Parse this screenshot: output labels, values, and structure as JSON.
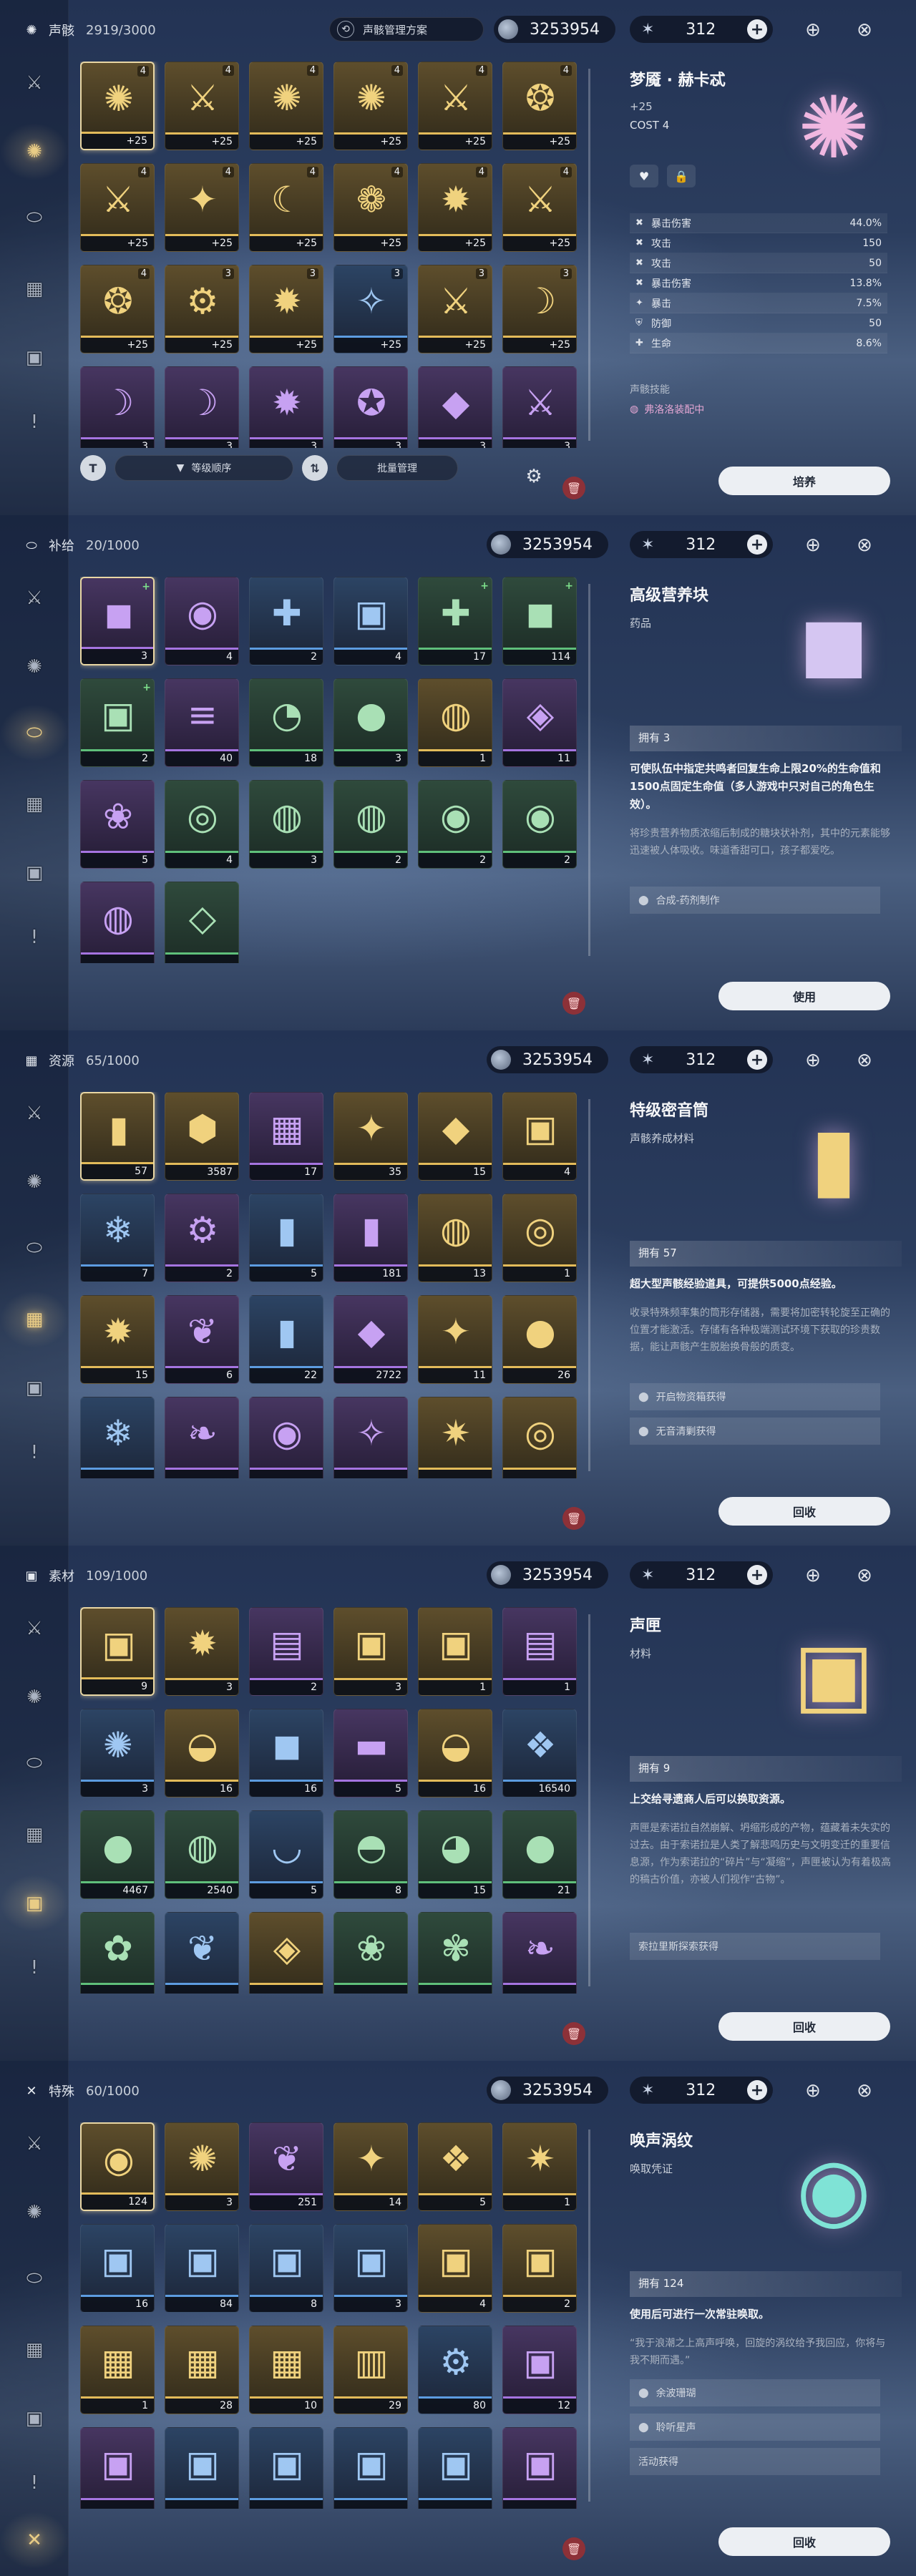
{
  "common": {
    "coins": "3253954",
    "astrite": "312",
    "trash_icon": "trash-icon"
  },
  "panels": [
    {
      "category": "声骸",
      "count": "2919/3000",
      "cat_icon": "echo-icon",
      "scheme_label": "声骸管理方案",
      "sort_label": "等级顺序",
      "bulk_label": "批量管理",
      "detail": {
        "name": "梦魇 · 赫卡忒",
        "level": "+25",
        "cost": "COST  4",
        "stats": [
          [
            "暴击伤害",
            "44.0%"
          ],
          [
            "攻击",
            "150"
          ],
          [
            "攻击",
            "50"
          ],
          [
            "暴击伤害",
            "13.8%"
          ],
          [
            "暴击",
            "7.5%"
          ],
          [
            "防御",
            "50"
          ],
          [
            "生命",
            "8.6%"
          ]
        ],
        "skill_label": "声骸技能",
        "equip_label": "弗洛洛装配中"
      },
      "button": "培养",
      "items": [
        {
          "icon": "echo-hecate",
          "glyph": "✺",
          "rarity": "gold",
          "cnt": "+25",
          "cost": "4",
          "sel": true
        },
        {
          "icon": "echo-knight",
          "glyph": "⚔",
          "rarity": "gold",
          "cnt": "+25",
          "cost": "4"
        },
        {
          "icon": "echo-hecate",
          "glyph": "✺",
          "rarity": "gold",
          "cnt": "+25",
          "cost": "4"
        },
        {
          "icon": "echo-hecate",
          "glyph": "✺",
          "rarity": "gold",
          "cnt": "+25",
          "cost": "4"
        },
        {
          "icon": "echo-knight",
          "glyph": "⚔",
          "rarity": "gold",
          "cnt": "+25",
          "cost": "4"
        },
        {
          "icon": "echo-guardian",
          "glyph": "❂",
          "rarity": "gold",
          "cnt": "+25",
          "cost": "4"
        },
        {
          "icon": "echo-knight",
          "glyph": "⚔",
          "rarity": "gold",
          "cnt": "+25",
          "cost": "4"
        },
        {
          "icon": "echo-guardian",
          "glyph": "✦",
          "rarity": "gold",
          "cnt": "+25",
          "cost": "4"
        },
        {
          "icon": "echo-serpent",
          "glyph": "☾",
          "rarity": "gold",
          "cnt": "+25",
          "cost": "4"
        },
        {
          "icon": "echo-dragon",
          "glyph": "❁",
          "rarity": "gold",
          "cnt": "+25",
          "cost": "4"
        },
        {
          "icon": "echo-beast",
          "glyph": "✹",
          "rarity": "gold",
          "cnt": "+25",
          "cost": "4"
        },
        {
          "icon": "echo-knight",
          "glyph": "⚔",
          "rarity": "gold",
          "cnt": "+25",
          "cost": "4"
        },
        {
          "icon": "echo-guardian",
          "glyph": "❂",
          "rarity": "gold",
          "cnt": "+25",
          "cost": "4"
        },
        {
          "icon": "echo-mech",
          "glyph": "⚙",
          "rarity": "gold",
          "cnt": "+25",
          "cost": "3"
        },
        {
          "icon": "echo-beast",
          "glyph": "✹",
          "rarity": "gold",
          "cnt": "+25",
          "cost": "3"
        },
        {
          "icon": "echo-crystal",
          "glyph": "✧",
          "rarity": "blue",
          "cnt": "+25",
          "cost": "3"
        },
        {
          "icon": "echo-knight",
          "glyph": "⚔",
          "rarity": "gold",
          "cnt": "+25",
          "cost": "3"
        },
        {
          "icon": "echo-scythe",
          "glyph": "☽",
          "rarity": "gold",
          "cnt": "+25",
          "cost": "3"
        },
        {
          "icon": "echo-scythe",
          "glyph": "☽",
          "rarity": "purple",
          "cnt": "3",
          "cost": ""
        },
        {
          "icon": "echo-scythe",
          "glyph": "☽",
          "rarity": "purple",
          "cnt": "3",
          "cost": ""
        },
        {
          "icon": "echo-beast",
          "glyph": "✹",
          "rarity": "purple",
          "cnt": "3",
          "cost": ""
        },
        {
          "icon": "echo-orb",
          "glyph": "✪",
          "rarity": "purple",
          "cnt": "3",
          "cost": ""
        },
        {
          "icon": "echo-rock",
          "glyph": "◆",
          "rarity": "purple",
          "cnt": "3",
          "cost": ""
        },
        {
          "icon": "echo-knight",
          "glyph": "⚔",
          "rarity": "purple",
          "cnt": "3",
          "cost": ""
        }
      ]
    },
    {
      "category": "补给",
      "count": "20/1000",
      "cat_icon": "pill-icon",
      "detail": {
        "name": "高级营养块",
        "sub": "药品",
        "own": "拥有 3",
        "desc": "可使队伍中指定共鸣者回复生命上限20%的生命值和1500点固定生命值（多人游戏中只对自己的角色生效）。",
        "flavor": "将珍贵营养物质浓缩后制成的糖块状补剂，其中的元素能够迅速被人体吸收。味道香甜可口，孩子都爱吃。",
        "sources": [
          "合成-药剂制作"
        ]
      },
      "button": "使用",
      "items": [
        {
          "icon": "nutrient-block",
          "glyph": "◼",
          "rarity": "purple",
          "cnt": "3",
          "sel": true,
          "tag": "+"
        },
        {
          "icon": "stew",
          "glyph": "◉",
          "rarity": "purple",
          "cnt": "4",
          "tag": ""
        },
        {
          "icon": "bandage",
          "glyph": "✚",
          "rarity": "blue",
          "cnt": "2",
          "tag": ""
        },
        {
          "icon": "medkit",
          "glyph": "▣",
          "rarity": "blue",
          "cnt": "4",
          "tag": ""
        },
        {
          "icon": "bandage",
          "glyph": "✚",
          "rarity": "green",
          "cnt": "17",
          "tag": "+"
        },
        {
          "icon": "nutrient-block",
          "glyph": "◼",
          "rarity": "green",
          "cnt": "114",
          "tag": "+"
        },
        {
          "icon": "medkit",
          "glyph": "▣",
          "rarity": "green",
          "cnt": "2",
          "tag": "+"
        },
        {
          "icon": "skewer",
          "glyph": "≡",
          "rarity": "purple",
          "cnt": "40",
          "tag": ""
        },
        {
          "icon": "pie",
          "glyph": "◔",
          "rarity": "green",
          "cnt": "18",
          "tag": ""
        },
        {
          "icon": "dumpling",
          "glyph": "●",
          "rarity": "green",
          "cnt": "3",
          "tag": ""
        },
        {
          "icon": "soup",
          "glyph": "◍",
          "rarity": "gold",
          "cnt": "1",
          "tag": ""
        },
        {
          "icon": "grill",
          "glyph": "◈",
          "rarity": "purple",
          "cnt": "11",
          "tag": ""
        },
        {
          "icon": "berry-bowl",
          "glyph": "❀",
          "rarity": "purple",
          "cnt": "5",
          "tag": ""
        },
        {
          "icon": "rice-bowl",
          "glyph": "◎",
          "rarity": "green",
          "cnt": "4",
          "tag": ""
        },
        {
          "icon": "noodles",
          "glyph": "◍",
          "rarity": "green",
          "cnt": "3",
          "tag": ""
        },
        {
          "icon": "noodles",
          "glyph": "◍",
          "rarity": "green",
          "cnt": "2",
          "tag": ""
        },
        {
          "icon": "curry",
          "glyph": "◉",
          "rarity": "green",
          "cnt": "2",
          "tag": ""
        },
        {
          "icon": "curry",
          "glyph": "◉",
          "rarity": "green",
          "cnt": "2",
          "tag": ""
        },
        {
          "icon": "soup",
          "glyph": "◍",
          "rarity": "purple",
          "cnt": "",
          "tag": ""
        },
        {
          "icon": "pastry",
          "glyph": "◇",
          "rarity": "green",
          "cnt": "",
          "tag": ""
        }
      ]
    },
    {
      "category": "资源",
      "count": "65/1000",
      "cat_icon": "resource-icon",
      "detail": {
        "name": "特级密音筒",
        "sub": "声骸养成材料",
        "own": "拥有 57",
        "desc": "超大型声骸经验道具，可提供5000点经验。",
        "flavor": "收录特殊频率集的筒形存储器，需要将加密转轮旋至正确的位置才能激活。存储有各种极端测试环境下获取的珍贵数据，能让声骸产生脱胎换骨般的质变。",
        "sources": [
          "开启物资箱获得",
          "无音清剿获得"
        ]
      },
      "button": "回收",
      "items": [
        {
          "icon": "premium-tuner",
          "glyph": "▮",
          "rarity": "gold",
          "cnt": "57",
          "sel": true
        },
        {
          "icon": "shell-credit",
          "glyph": "⬢",
          "rarity": "gold",
          "cnt": "3587"
        },
        {
          "icon": "sealed-tube",
          "glyph": "▦",
          "rarity": "purple",
          "cnt": "17"
        },
        {
          "icon": "star-shard",
          "glyph": "✦",
          "rarity": "gold",
          "cnt": "35"
        },
        {
          "icon": "crystal-ore",
          "glyph": "◆",
          "rarity": "gold",
          "cnt": "15"
        },
        {
          "icon": "cube-core",
          "glyph": "▣",
          "rarity": "gold",
          "cnt": "4"
        },
        {
          "icon": "ice-shard",
          "glyph": "❄",
          "rarity": "blue",
          "cnt": "7"
        },
        {
          "icon": "mech-core",
          "glyph": "⚙",
          "rarity": "purple",
          "cnt": "2"
        },
        {
          "icon": "tube",
          "glyph": "▮",
          "rarity": "blue",
          "cnt": "5"
        },
        {
          "icon": "medium-tube",
          "glyph": "▮",
          "rarity": "purple",
          "cnt": "181"
        },
        {
          "icon": "orb",
          "glyph": "◍",
          "rarity": "gold",
          "cnt": "13"
        },
        {
          "icon": "spiral-shell",
          "glyph": "◎",
          "rarity": "gold",
          "cnt": "1"
        },
        {
          "icon": "flame-crystal",
          "glyph": "✹",
          "rarity": "gold",
          "cnt": "15"
        },
        {
          "icon": "feather",
          "glyph": "❦",
          "rarity": "purple",
          "cnt": "6"
        },
        {
          "icon": "tube-small",
          "glyph": "▮",
          "rarity": "blue",
          "cnt": "22"
        },
        {
          "icon": "purple-gem",
          "glyph": "◆",
          "rarity": "purple",
          "cnt": "2722"
        },
        {
          "icon": "star-shard",
          "glyph": "✦",
          "rarity": "gold",
          "cnt": "11"
        },
        {
          "icon": "dark-orb",
          "glyph": "●",
          "rarity": "gold",
          "cnt": "26"
        },
        {
          "icon": "ice-shard",
          "glyph": "❄",
          "rarity": "blue",
          "cnt": ""
        },
        {
          "icon": "claw",
          "glyph": "❧",
          "rarity": "purple",
          "cnt": ""
        },
        {
          "icon": "red-core",
          "glyph": "◉",
          "rarity": "purple",
          "cnt": ""
        },
        {
          "icon": "star-shard",
          "glyph": "✧",
          "rarity": "purple",
          "cnt": ""
        },
        {
          "icon": "sun-star",
          "glyph": "✷",
          "rarity": "gold",
          "cnt": ""
        },
        {
          "icon": "spiral-shell",
          "glyph": "◎",
          "rarity": "gold",
          "cnt": ""
        }
      ]
    },
    {
      "category": "素材",
      "count": "109/1000",
      "cat_icon": "material-icon",
      "detail": {
        "name": "声匣",
        "sub": "材料",
        "own": "拥有 9",
        "desc": "上交给寻遗商人后可以换取资源。",
        "flavor": "声匣是索诺拉自然崩解、坍缩形成的产物，蕴藏着未失实的过去。由于索诺拉是人类了解悲鸣历史与文明变迁的重要信息源，作为索诺拉的“碎片”与“凝缩”，声匣被认为有着极高的稿古价值，亦被人们视作“古物”。",
        "sources": [
          "索拉里斯探索获得"
        ]
      },
      "button": "回收",
      "items": [
        {
          "icon": "sound-box",
          "glyph": "▣",
          "rarity": "gold",
          "cnt": "9",
          "sel": true
        },
        {
          "icon": "golden-spark",
          "glyph": "✹",
          "rarity": "gold",
          "cnt": "3"
        },
        {
          "icon": "data-card",
          "glyph": "▤",
          "rarity": "purple",
          "cnt": "2"
        },
        {
          "icon": "sound-box",
          "glyph": "▣",
          "rarity": "gold",
          "cnt": "3"
        },
        {
          "icon": "sound-box",
          "glyph": "▣",
          "rarity": "gold",
          "cnt": "1"
        },
        {
          "icon": "data-card",
          "glyph": "▤",
          "rarity": "purple",
          "cnt": "1"
        },
        {
          "icon": "whirl",
          "glyph": "✺",
          "rarity": "blue",
          "cnt": "3"
        },
        {
          "icon": "potion",
          "glyph": "◒",
          "rarity": "gold",
          "cnt": "16"
        },
        {
          "icon": "metal-cube",
          "glyph": "◼",
          "rarity": "blue",
          "cnt": "16"
        },
        {
          "icon": "brick",
          "glyph": "▬",
          "rarity": "purple",
          "cnt": "5"
        },
        {
          "icon": "potion",
          "glyph": "◒",
          "rarity": "gold",
          "cnt": "16"
        },
        {
          "icon": "blue-crystal",
          "glyph": "❖",
          "rarity": "blue",
          "cnt": "16540"
        },
        {
          "icon": "stone-ball",
          "glyph": "●",
          "rarity": "green",
          "cnt": "4467"
        },
        {
          "icon": "green-capsule",
          "glyph": "◍",
          "rarity": "green",
          "cnt": "2540"
        },
        {
          "icon": "tea-cup",
          "glyph": "◡",
          "rarity": "blue",
          "cnt": "5"
        },
        {
          "icon": "bowl",
          "glyph": "◓",
          "rarity": "green",
          "cnt": "8"
        },
        {
          "icon": "bread",
          "glyph": "◕",
          "rarity": "green",
          "cnt": "15"
        },
        {
          "icon": "red-fruit",
          "glyph": "●",
          "rarity": "green",
          "cnt": "21"
        },
        {
          "icon": "blue-flower",
          "glyph": "✿",
          "rarity": "green",
          "cnt": ""
        },
        {
          "icon": "silver-leaf",
          "glyph": "❦",
          "rarity": "blue",
          "cnt": ""
        },
        {
          "icon": "gold-seed",
          "glyph": "◈",
          "rarity": "gold",
          "cnt": ""
        },
        {
          "icon": "pink-lily",
          "glyph": "❀",
          "rarity": "green",
          "cnt": ""
        },
        {
          "icon": "red-flower",
          "glyph": "✾",
          "rarity": "green",
          "cnt": ""
        },
        {
          "icon": "coral-branch",
          "glyph": "❧",
          "rarity": "purple",
          "cnt": ""
        }
      ]
    },
    {
      "category": "特殊",
      "count": "60/1000",
      "cat_icon": "special-icon",
      "detail": {
        "name": "唤声涡纹",
        "sub": "唤取凭证",
        "own": "拥有 124",
        "desc": "使用后可进行一次常驻唤取。",
        "flavor": "“我于浪潮之上高声呼唤，回旋的涡纹给予我回应，你将与我不期而遇。”",
        "sources": [
          "余波珊瑚",
          "聆听星声",
          "活动获得"
        ]
      },
      "button": "回收",
      "items": [
        {
          "icon": "lustrous-tide",
          "glyph": "◉",
          "rarity": "gold",
          "cnt": "124",
          "sel": true
        },
        {
          "icon": "radiant-tide",
          "glyph": "✺",
          "rarity": "gold",
          "cnt": "3"
        },
        {
          "icon": "coral",
          "glyph": "❦",
          "rarity": "purple",
          "cnt": "251"
        },
        {
          "icon": "dagger",
          "glyph": "✦",
          "rarity": "gold",
          "cnt": "14"
        },
        {
          "icon": "green-badge",
          "glyph": "❖",
          "rarity": "gold",
          "cnt": "5"
        },
        {
          "icon": "golden-star",
          "glyph": "✷",
          "rarity": "gold",
          "cnt": "1"
        },
        {
          "icon": "supply-chest",
          "glyph": "▣",
          "rarity": "blue",
          "cnt": "16"
        },
        {
          "icon": "supply-chest",
          "glyph": "▣",
          "rarity": "blue",
          "cnt": "84"
        },
        {
          "icon": "supply-chest",
          "glyph": "▣",
          "rarity": "blue",
          "cnt": "8"
        },
        {
          "icon": "supply-chest",
          "glyph": "▣",
          "rarity": "blue",
          "cnt": "3"
        },
        {
          "icon": "gold-chest",
          "glyph": "▣",
          "rarity": "gold",
          "cnt": "4"
        },
        {
          "icon": "gold-chest",
          "glyph": "▣",
          "rarity": "gold",
          "cnt": "2"
        },
        {
          "icon": "yellow-chest",
          "glyph": "▦",
          "rarity": "gold",
          "cnt": "1"
        },
        {
          "icon": "yellow-chest",
          "glyph": "▦",
          "rarity": "gold",
          "cnt": "28"
        },
        {
          "icon": "yellow-chest",
          "glyph": "▦",
          "rarity": "gold",
          "cnt": "10"
        },
        {
          "icon": "glass-box",
          "glyph": "▥",
          "rarity": "gold",
          "cnt": "29"
        },
        {
          "icon": "gear-canister",
          "glyph": "⚙",
          "rarity": "blue",
          "cnt": "80"
        },
        {
          "icon": "red-chest",
          "glyph": "▣",
          "rarity": "purple",
          "cnt": "12"
        },
        {
          "icon": "red-chest",
          "glyph": "▣",
          "rarity": "purple",
          "cnt": ""
        },
        {
          "icon": "supply-chest",
          "glyph": "▣",
          "rarity": "blue",
          "cnt": ""
        },
        {
          "icon": "supply-chest",
          "glyph": "▣",
          "rarity": "blue",
          "cnt": ""
        },
        {
          "icon": "supply-chest",
          "glyph": "▣",
          "rarity": "blue",
          "cnt": ""
        },
        {
          "icon": "supply-chest",
          "glyph": "▣",
          "rarity": "blue",
          "cnt": ""
        },
        {
          "icon": "red-chest",
          "glyph": "▣",
          "rarity": "purple",
          "cnt": ""
        }
      ]
    }
  ],
  "sidebar_icons": [
    {
      "icon": "sword-icon",
      "glyph": "⚔"
    },
    {
      "icon": "echo-icon",
      "glyph": "✺"
    },
    {
      "icon": "pill-icon",
      "glyph": "⬭"
    },
    {
      "icon": "resource-icon",
      "glyph": "▦"
    },
    {
      "icon": "material-icon",
      "glyph": "▣"
    },
    {
      "icon": "task-icon",
      "glyph": "!"
    },
    {
      "icon": "special-icon",
      "glyph": "✕"
    }
  ]
}
